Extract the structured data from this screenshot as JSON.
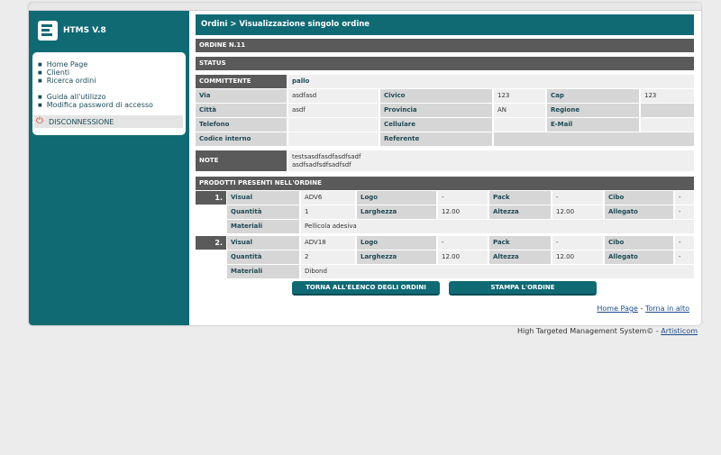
{
  "app": {
    "title": "HTMS V.8"
  },
  "menu": {
    "items": [
      "Home Page",
      "Clienti",
      "Ricerca ordini"
    ],
    "items2": [
      "Guida all'utilizzo",
      "Modifica password di accesso"
    ],
    "logout": "DISCONNESSIONE"
  },
  "header": {
    "title": "Ordini > Visualizzazione singolo ordine"
  },
  "order": {
    "number": "ORDINE N.11",
    "status_label": "STATUS",
    "committente_label": "COMMITTENTE",
    "committente_value": "pallo",
    "via_label": "Via",
    "via_value": "asdfasd",
    "civico_label": "Civico",
    "civico_value": "123",
    "cap_label": "Cap",
    "cap_value": "123",
    "citta_label": "Città",
    "citta_value": "asdf",
    "provincia_label": "Provincia",
    "provincia_value": "AN",
    "regione_label": "Regione",
    "regione_value": "",
    "telefono_label": "Telefono",
    "telefono_value": "",
    "cellulare_label": "Cellulare",
    "cellulare_value": "",
    "email_label": "E-Mail",
    "email_value": "",
    "codice_label": "Codice interno",
    "codice_value": "",
    "referente_label": "Referente",
    "referente_value": "",
    "note_label": "NOTE",
    "note_line1": "testsasdfasdfasdfsadf",
    "note_line2": "asdfsadfsdfsadfsdf"
  },
  "products": {
    "header": "PRODOTTI PRESENTI NELL'ORDINE",
    "labels": {
      "visual": "Visual",
      "logo": "Logo",
      "pack": "Pack",
      "cibo": "Cibo",
      "quantita": "Quantità",
      "larghezza": "Larghezza",
      "altezza": "Altezza",
      "allegato": "Allegato",
      "materiali": "Materiali"
    },
    "items": [
      {
        "num": "1.",
        "visual": "ADV6",
        "logo": "-",
        "pack": "-",
        "cibo": "-",
        "quantita": "1",
        "larghezza": "12.00",
        "altezza": "12.00",
        "allegato": "-",
        "materiali": "Pellicola adesiva"
      },
      {
        "num": "2.",
        "visual": "ADV18",
        "logo": "-",
        "pack": "-",
        "cibo": "-",
        "quantita": "2",
        "larghezza": "12.00",
        "altezza": "12.00",
        "allegato": "-",
        "materiali": "Dibond"
      }
    ]
  },
  "buttons": {
    "back": "TORNA ALL'ELENCO DEGLI ORDINI",
    "print": "STAMPA L'ORDINE"
  },
  "footer": {
    "home": "Home Page",
    "sep": "-",
    "top": "Torna in alto",
    "credit": "High Targeted Management System© -",
    "credit_link": "Artisticom"
  },
  "colors": {
    "accent": "#0f6a74",
    "dark_bar": "#5a5a5a",
    "label_bg": "#d6d6d6",
    "value_bg": "#efefef"
  },
  "icons": {
    "logo": "htms-logo-icon",
    "logout": "power-icon",
    "bullet": "square-bullet-icon"
  }
}
